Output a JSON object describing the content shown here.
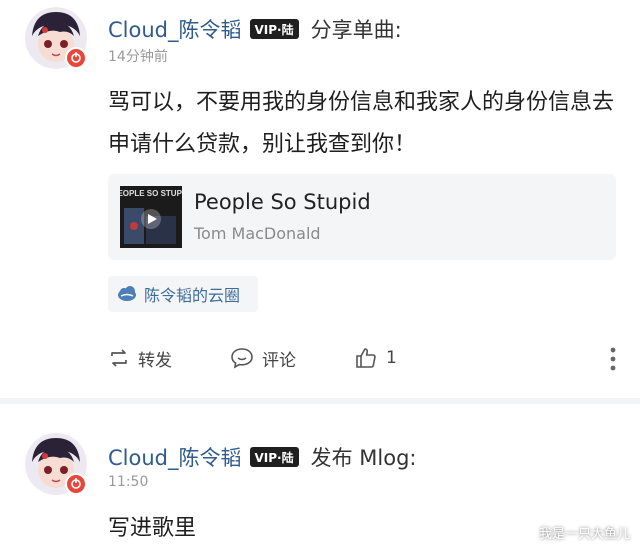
{
  "posts": [
    {
      "username": "Cloud_陈令韬",
      "vip_badge": "VIP·陆",
      "action": "分享单曲:",
      "timestamp": "14分钟前",
      "content": "骂可以，不要用我的身份信息和我家人的身份信息去申请什么贷款，别让我查到你！",
      "music": {
        "title": "People So Stupid",
        "artist": "Tom MacDonald",
        "album_art_text": "PEOPLE SO STUPID"
      },
      "circle_tag": "陈令韬的云圈",
      "actions": {
        "repost": "转发",
        "comment": "评论",
        "like_count": "1"
      }
    },
    {
      "username": "Cloud_陈令韬",
      "vip_badge": "VIP·陆",
      "action": "发布 Mlog:",
      "timestamp": "11:50",
      "content": "写进歌里"
    }
  ],
  "watermark": "我是一只大鱼儿",
  "colors": {
    "username": "#2f5b8d",
    "divider": "#f3f4f6",
    "card_bg": "#f4f5f7",
    "avatar_badge": "#e8463a"
  }
}
